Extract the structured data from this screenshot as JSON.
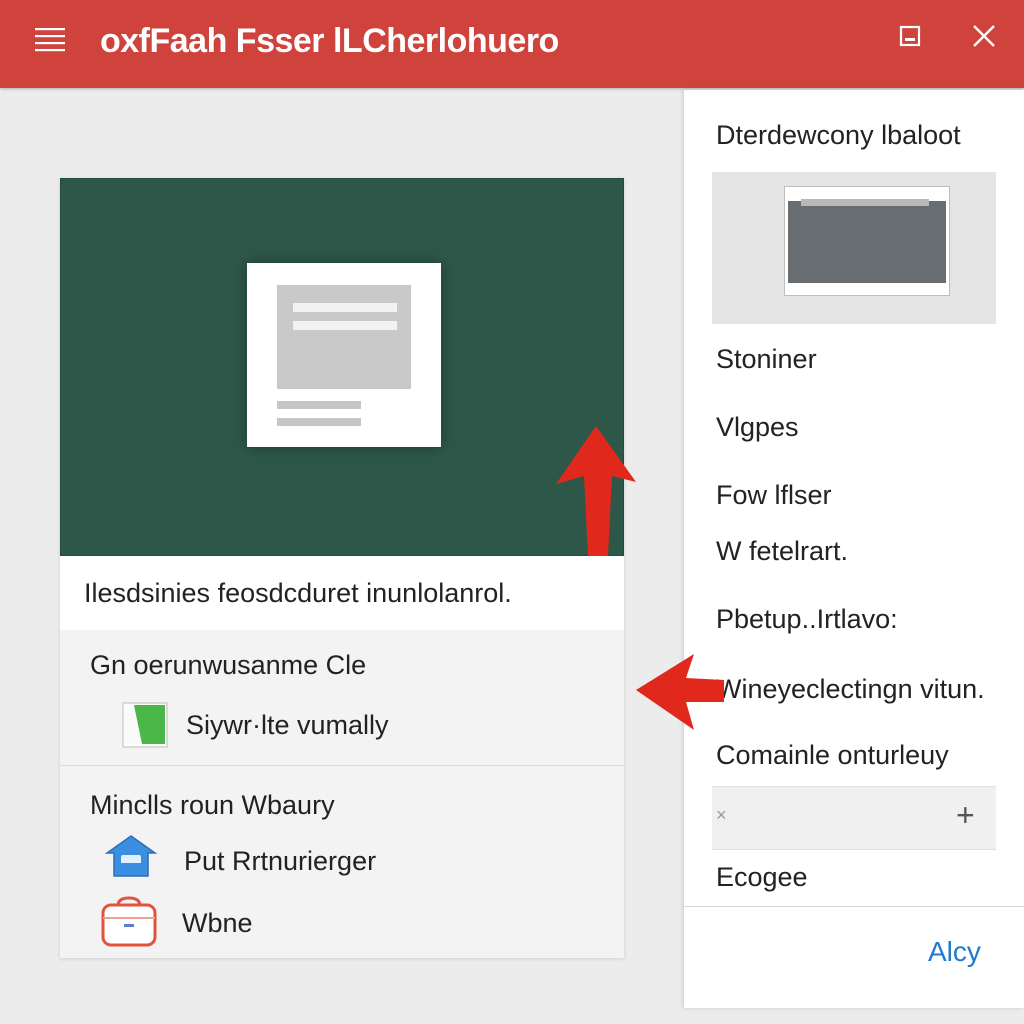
{
  "window": {
    "title": "oxfFaah Fsser lLCherlohuero",
    "menu_icon": "hamburger-icon",
    "maximize_icon": "maximize-icon",
    "close_icon": "close-icon",
    "accent_color": "#cf433c"
  },
  "left_card": {
    "preview_bg": "#2d5849",
    "caption": "Ilesdsinies feosdcduret inunlolanrol.",
    "section1": {
      "title": "Gn oerunwusanme Cle",
      "items": [
        {
          "label": "Siywr·lte vumally",
          "icon": "green-square-icon"
        }
      ]
    },
    "section2": {
      "title": "Minclls roun Wbaury",
      "items": [
        {
          "label": "Put Rrtnurierger",
          "icon": "blue-house-icon"
        },
        {
          "label": "Wbne",
          "icon": "red-bag-icon"
        }
      ]
    }
  },
  "right_panel": {
    "title": "Dterdewcony lbaloot",
    "items": [
      "Stoniner",
      "Vlgpes",
      "Fow lflser",
      "W fetelrart.",
      "Pbetup..Irtlavo:",
      "Wineyeclectingn vitun.",
      "Comainle onturleuy"
    ],
    "input_clear_glyph": "×",
    "input_add_glyph": "+",
    "bottom_item": "Ecogee",
    "apply_label": "Alcy",
    "link_color": "#1f7ad0"
  },
  "annotations": {
    "arrow_color": "#e0281c"
  }
}
